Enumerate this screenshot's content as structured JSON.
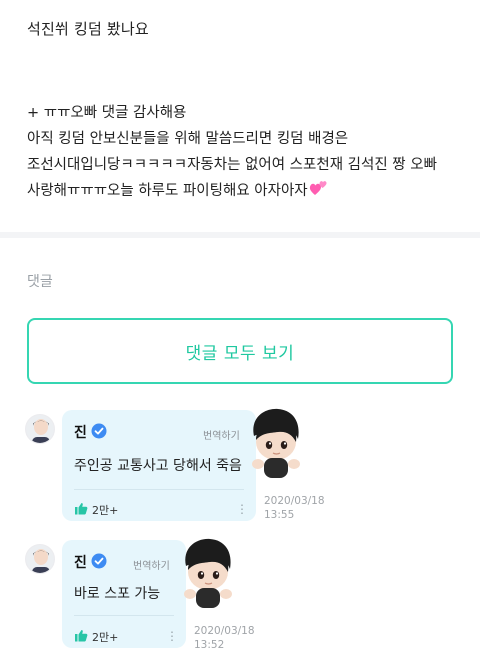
{
  "post": {
    "title": "석진쒸 킹덤 봤나요",
    "body_lines": [
      "+ ㅠㅠ오빠 댓글 감사해용",
      "아직 킹덤 안보신분들을 위해 말씀드리면 킹덤 배경은",
      "조선시대입니당ㅋㅋㅋㅋㅋ자동차는 없어여 스포천재 김석진 짱 오빠",
      "사랑해ㅠㅠㅠ오늘 하루도 파이팅해요 아자아자"
    ],
    "body_trailing_icon": "two-hearts-emoji"
  },
  "comments_label": "댓글",
  "view_all_label": "댓글 모두 보기",
  "comments": [
    {
      "author": "진",
      "verified_icon": "verified-badge-icon",
      "translate_label": "번역하기",
      "text": "주인공 교통사고 당해서 죽음",
      "likes": "2만+",
      "date": "2020/03/18",
      "time": "13:55",
      "sticker": "jin-character-peek-sticker"
    },
    {
      "author": "진",
      "verified_icon": "verified-badge-icon",
      "translate_label": "번역하기",
      "text": "바로 스포 가능",
      "likes": "2만+",
      "date": "2020/03/18",
      "time": "13:52",
      "sticker": "jin-character-peek-sticker"
    }
  ],
  "colors": {
    "accent": "#1fc8a0",
    "accent_border": "#35d6b2",
    "bubble": "#e6f6fc",
    "verified": "#3d8bf2",
    "like": "#27c5a6",
    "heart": "#ff5db1"
  }
}
